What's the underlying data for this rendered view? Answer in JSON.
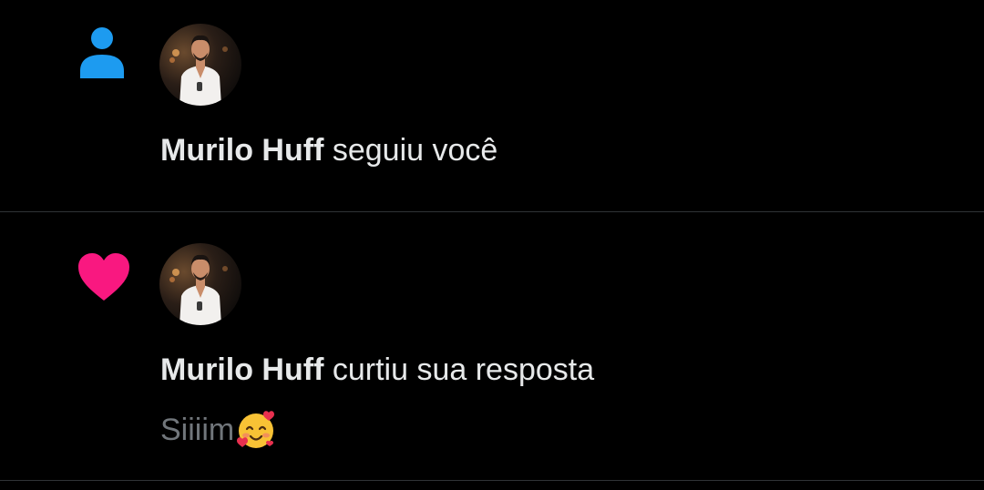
{
  "notifications": [
    {
      "type_icon": "person-icon",
      "icon_color": "#1d9bf0",
      "user_name": "Murilo Huff",
      "action_text": "seguiu você"
    },
    {
      "type_icon": "heart-icon",
      "icon_color": "#f91880",
      "user_name": "Murilo Huff",
      "action_text": "curtiu sua resposta",
      "reply_text": "Siiiim",
      "reply_emoji": "smiling-face-with-hearts"
    }
  ],
  "colors": {
    "background": "#000000",
    "text_primary": "#e7e9ea",
    "text_secondary": "#71767b",
    "divider": "#2f3336"
  }
}
